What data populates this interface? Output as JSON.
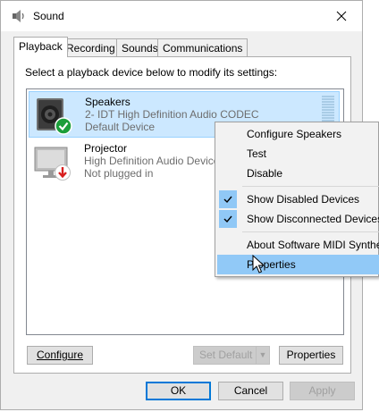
{
  "window": {
    "title": "Sound",
    "app_icon": "speaker-icon",
    "close_icon": "close-icon"
  },
  "tabs": [
    {
      "label": "Playback",
      "active": true
    },
    {
      "label": "Recording",
      "active": false
    },
    {
      "label": "Sounds",
      "active": false
    },
    {
      "label": "Communications",
      "active": false
    }
  ],
  "instruction": "Select a playback device below to modify its settings:",
  "devices": [
    {
      "name": "Speakers",
      "line1": "2- IDT High Definition Audio CODEC",
      "line2": "Default Device",
      "icon": "speakers-icon",
      "badge": "green-check-badge",
      "selected": true
    },
    {
      "name": "Projector",
      "line1": "High Definition Audio Device",
      "line2": "Not plugged in",
      "icon": "projector-icon",
      "badge": "red-arrow-badge",
      "selected": false
    }
  ],
  "buttons": {
    "configure": "Configure",
    "set_default": "Set Default",
    "properties": "Properties",
    "ok": "OK",
    "cancel": "Cancel",
    "apply": "Apply"
  },
  "context_menu": {
    "items": [
      {
        "label": "Configure Speakers",
        "checked": false
      },
      {
        "label": "Test",
        "checked": false
      },
      {
        "label": "Disable",
        "checked": false
      },
      {
        "label": "Show Disabled Devices",
        "checked": true
      },
      {
        "label": "Show Disconnected Devices",
        "checked": true
      },
      {
        "label": "About Software MIDI Synthe",
        "checked": false
      },
      {
        "label": "Properties",
        "checked": false,
        "hover": true
      }
    ]
  },
  "colors": {
    "selection_bg": "#cce8ff",
    "menu_hover": "#91c9f7",
    "accent": "#0078d7"
  }
}
